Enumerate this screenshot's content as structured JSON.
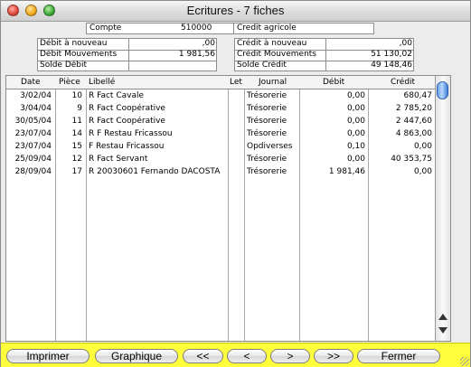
{
  "window": {
    "title": "Ecritures - 7 fiches"
  },
  "account": {
    "label": "Compte",
    "number": "510000",
    "name": "Credit agricole"
  },
  "summary": {
    "left": [
      {
        "label": "Débit à nouveau",
        "value": ",00"
      },
      {
        "label": "Débit Mouvements",
        "value": "1 981,56"
      },
      {
        "label": "Solde Débit",
        "value": ""
      }
    ],
    "right": [
      {
        "label": "Crédit à nouveau",
        "value": ",00"
      },
      {
        "label": "Crédit Mouvements",
        "value": "51 130,02"
      },
      {
        "label": "Solde Crédit",
        "value": "49 148,46"
      }
    ]
  },
  "table": {
    "columns": [
      "Date",
      "Pièce",
      "Libellé",
      "Let",
      "Journal",
      "Débit",
      "Crédit"
    ],
    "rows": [
      [
        "3/02/04",
        "10",
        "R Fact Cavale",
        "",
        "Trésorerie",
        "0,00",
        "680,47"
      ],
      [
        "3/04/04",
        "9",
        "R Fact Coopérative",
        "",
        "Trésorerie",
        "0,00",
        "2 785,20"
      ],
      [
        "30/05/04",
        "11",
        "R Fact Coopérative",
        "",
        "Trésorerie",
        "0,00",
        "2 447,60"
      ],
      [
        "23/07/04",
        "14",
        "R F Restau Fricassou",
        "",
        "Trésorerie",
        "0,00",
        "4 863,00"
      ],
      [
        "23/07/04",
        "15",
        "F Restau Fricassou",
        "",
        "Opdiverses",
        "0,10",
        "0,00"
      ],
      [
        "25/09/04",
        "12",
        "R Fact Servant",
        "",
        "Trésorerie",
        "0,00",
        "40 353,75"
      ],
      [
        "28/09/04",
        "17",
        "R 20030601 Fernando DACOSTA",
        "",
        "Trésorerie",
        "1 981,46",
        "0,00"
      ]
    ]
  },
  "buttons": {
    "print": "Imprimer",
    "graph": "Graphique",
    "first": "<<",
    "prev": "<",
    "next": ">",
    "last": ">>",
    "close": "Fermer"
  },
  "colors": {
    "button_bar": "#fefe3c",
    "scroll_thumb": "#5b95e6"
  }
}
